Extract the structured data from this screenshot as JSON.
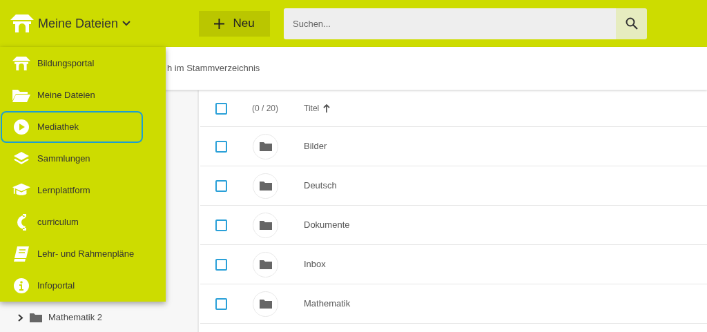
{
  "header": {
    "title": "Meine Dateien",
    "new_button": "Neu",
    "search": {
      "placeholder": "Suchen..."
    }
  },
  "menu": {
    "items": [
      {
        "label": "Bildungsportal",
        "focused": false
      },
      {
        "label": "Meine Dateien",
        "focused": false
      },
      {
        "label": "Mediathek",
        "focused": true
      },
      {
        "label": "Sammlungen",
        "focused": false
      },
      {
        "label": "Lernplattform",
        "focused": false
      },
      {
        "label": "curriculum",
        "focused": false
      },
      {
        "label": "Lehr- und Rahmenpläne",
        "focused": false
      },
      {
        "label": "Infoportal",
        "focused": false
      }
    ]
  },
  "breadcrumb": "h im Stammverzeichnis",
  "tree": {
    "items": [
      {
        "label": "Mathematik 2",
        "expanded": false
      }
    ]
  },
  "table": {
    "header": {
      "checked": false,
      "count": "(0 / 20)",
      "title_column": "Titel"
    },
    "rows": [
      {
        "title": "Bilder",
        "checked": false
      },
      {
        "title": "Deutsch",
        "checked": false
      },
      {
        "title": "Dokumente",
        "checked": false
      },
      {
        "title": "Inbox",
        "checked": false
      },
      {
        "title": "Mathematik",
        "checked": false
      }
    ]
  }
}
